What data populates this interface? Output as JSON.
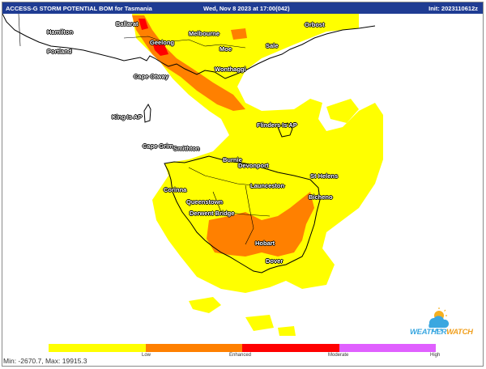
{
  "header": {
    "product": "ACCESS-G STORM POTENTIAL BOM for Tasmania",
    "valid_time": "Wed, Nov 8 2023 at 17:00(042)",
    "init": "Init: 2023110612z"
  },
  "places": [
    {
      "name": "Ballarat",
      "id": "ballarat"
    },
    {
      "name": "Hamilton",
      "id": "hamilton"
    },
    {
      "name": "Melbourne",
      "id": "melbourne"
    },
    {
      "name": "Geelong",
      "id": "geelong"
    },
    {
      "name": "Portland",
      "id": "portland"
    },
    {
      "name": "Moe",
      "id": "moe"
    },
    {
      "name": "Sale",
      "id": "sale"
    },
    {
      "name": "Orbost",
      "id": "orbost"
    },
    {
      "name": "Wonthaggi",
      "id": "wonthaggi"
    },
    {
      "name": "Cape Otway",
      "id": "cape-otway"
    },
    {
      "name": "King Is AP",
      "id": "king-is-ap"
    },
    {
      "name": "Flinders Is AP",
      "id": "flinders-is-ap"
    },
    {
      "name": "Cape Grim",
      "id": "cape-grim"
    },
    {
      "name": "Smithton",
      "id": "smithton"
    },
    {
      "name": "Burnie",
      "id": "burnie"
    },
    {
      "name": "Devonport",
      "id": "devonport"
    },
    {
      "name": "St Helens",
      "id": "st-helens"
    },
    {
      "name": "Launceston",
      "id": "launceston"
    },
    {
      "name": "Corinna",
      "id": "corinna"
    },
    {
      "name": "Bicheno",
      "id": "bicheno"
    },
    {
      "name": "Queenstown",
      "id": "queenstown"
    },
    {
      "name": "Derwent Bridge",
      "id": "derwent-bridge"
    },
    {
      "name": "Hobart",
      "id": "hobart"
    },
    {
      "name": "Dover",
      "id": "dover"
    }
  ],
  "legend": {
    "labels": [
      "Low",
      "Enhanced",
      "Moderate",
      "High"
    ],
    "colors": [
      "#ffff00",
      "#ff8000",
      "#ff0000",
      "#e060ff"
    ]
  },
  "stats": {
    "minmax": "Min: -2670.7, Max: 19915.3"
  },
  "branding": {
    "logo_main": "WEATHER",
    "logo_accent": "WATCH"
  }
}
